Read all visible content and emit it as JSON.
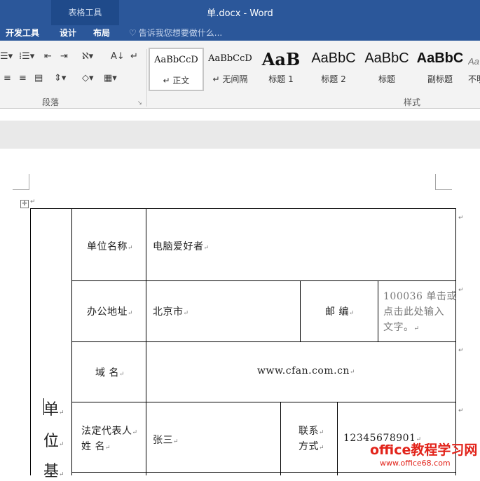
{
  "titlebar": {
    "context_tab_group": "表格工具",
    "document_title": "单.docx - Word"
  },
  "tabs": [
    "开发工具",
    "设计",
    "布局"
  ],
  "tell_me": {
    "placeholder": "告诉我您想要做什么..."
  },
  "paragraph_group": {
    "label": "段落"
  },
  "styles_group": {
    "label": "样式",
    "items": [
      {
        "sample": "AaBbCcD",
        "name": "正文",
        "selected": true
      },
      {
        "sample": "AaBbCcD",
        "name": "无间隔"
      },
      {
        "sample": "AaB",
        "name": "标题 1"
      },
      {
        "sample": "AaBbC",
        "name": "标题 2"
      },
      {
        "sample": "AaBbC",
        "name": "标题"
      },
      {
        "sample": "AaBbC",
        "name": "副标题"
      },
      {
        "sample": "Aa",
        "name": "不明"
      }
    ]
  },
  "table": {
    "section_vertical": [
      "单",
      "位",
      "基"
    ],
    "rows": [
      {
        "label": "单位名称",
        "value": "电脑爱好者"
      },
      {
        "label": "办公地址",
        "value": "北京市",
        "label2": "邮  编",
        "value2_lines": [
          "100036 单击或",
          "点击此处输入",
          "文字。"
        ]
      },
      {
        "label": "域  名",
        "value": "www.cfan.com.cn"
      },
      {
        "label_lines": [
          "法定代表人",
          "姓      名"
        ],
        "value": "张三",
        "label2_lines": [
          "联系",
          "方式"
        ],
        "value2": "12345678901"
      }
    ]
  },
  "watermark": {
    "line1": "office教程学习网",
    "line2": "www.office68.com"
  },
  "colors": {
    "ribbon_blue": "#2b579a",
    "ribbon_body": "#f3f3f3",
    "watermark_red": "#e2231a"
  }
}
